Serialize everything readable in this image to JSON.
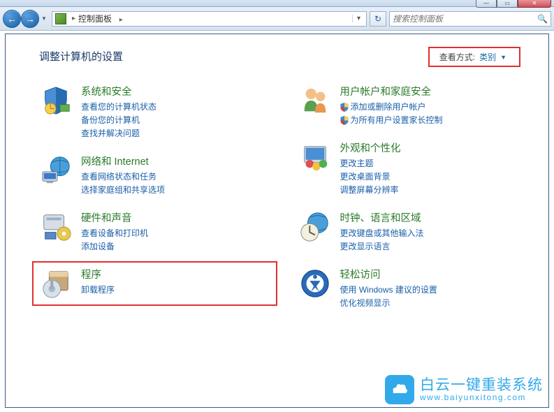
{
  "titlebar": {
    "min": "—",
    "max": "▭",
    "close": "✕"
  },
  "nav": {
    "back": "←",
    "forward": "→",
    "breadcrumb_root": "控制面板",
    "breadcrumb_sep": "▸",
    "refresh": "↻"
  },
  "search": {
    "placeholder": "搜索控制面板"
  },
  "page": {
    "title": "调整计算机的设置",
    "view_label": "查看方式:",
    "view_value": "类别"
  },
  "categories": {
    "left": [
      {
        "title": "系统和安全",
        "links": [
          "查看您的计算机状态",
          "备份您的计算机",
          "查找并解决问题"
        ]
      },
      {
        "title": "网络和 Internet",
        "links": [
          "查看网络状态和任务",
          "选择家庭组和共享选项"
        ]
      },
      {
        "title": "硬件和声音",
        "links": [
          "查看设备和打印机",
          "添加设备"
        ]
      },
      {
        "title": "程序",
        "links": [
          "卸载程序"
        ]
      }
    ],
    "right": [
      {
        "title": "用户帐户和家庭安全",
        "links": [
          "添加或删除用户帐户",
          "为所有用户设置家长控制"
        ],
        "shield": true
      },
      {
        "title": "外观和个性化",
        "links": [
          "更改主题",
          "更改桌面背景",
          "调整屏幕分辨率"
        ]
      },
      {
        "title": "时钟、语言和区域",
        "links": [
          "更改键盘或其他输入法",
          "更改显示语言"
        ]
      },
      {
        "title": "轻松访问",
        "links": [
          "使用 Windows 建议的设置",
          "优化视频显示"
        ]
      }
    ]
  },
  "watermark": {
    "main": "白云一键重装系统",
    "sub": "www.baiyunxitong.com"
  }
}
